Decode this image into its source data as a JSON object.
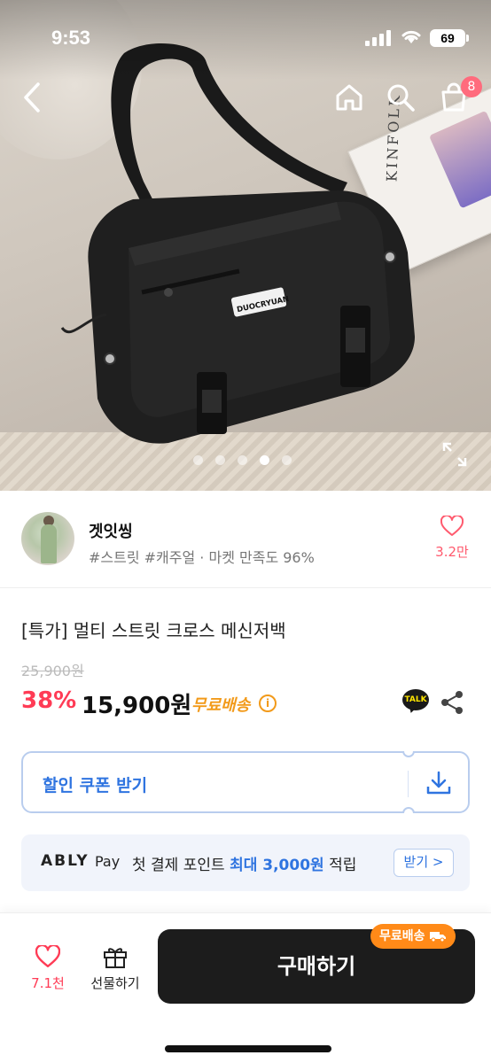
{
  "status_bar": {
    "time": "9:53",
    "battery": "69"
  },
  "nav": {
    "cart_count": "8"
  },
  "hero": {
    "book_title": "KINFOLK",
    "bag_label": "DUOCRYUAN",
    "pages": 5,
    "active_page": 4
  },
  "shop": {
    "name": "겟잇씽",
    "tags": "#스트릿 #캐주얼 · 마켓 만족도 96%",
    "likes": "3.2만"
  },
  "product": {
    "title": "[특가] 멀티 스트릿 크로스 메신저백",
    "original_price": "25,900원",
    "discount": "38%",
    "price": "15,900원",
    "shipping": "무료배송",
    "talk_label": "TALK"
  },
  "coupon": {
    "label": "할인 쿠폰 받기"
  },
  "ably_pay": {
    "brand": "ABLY",
    "pay": "Pay",
    "msg_prefix": "첫 결제 포인트",
    "msg_highlight": "최대 3,000원",
    "msg_suffix": "적립",
    "button": "받기 >"
  },
  "bottom_bar": {
    "like_count": "7.1천",
    "gift_label": "선물하기",
    "buy_label": "구매하기",
    "free_badge": "무료배송"
  },
  "colors": {
    "accent_pink": "#ff3b55",
    "accent_blue": "#2f74e0",
    "shipping_orange": "#f29a1a",
    "buy_button": "#1c1c1c"
  }
}
